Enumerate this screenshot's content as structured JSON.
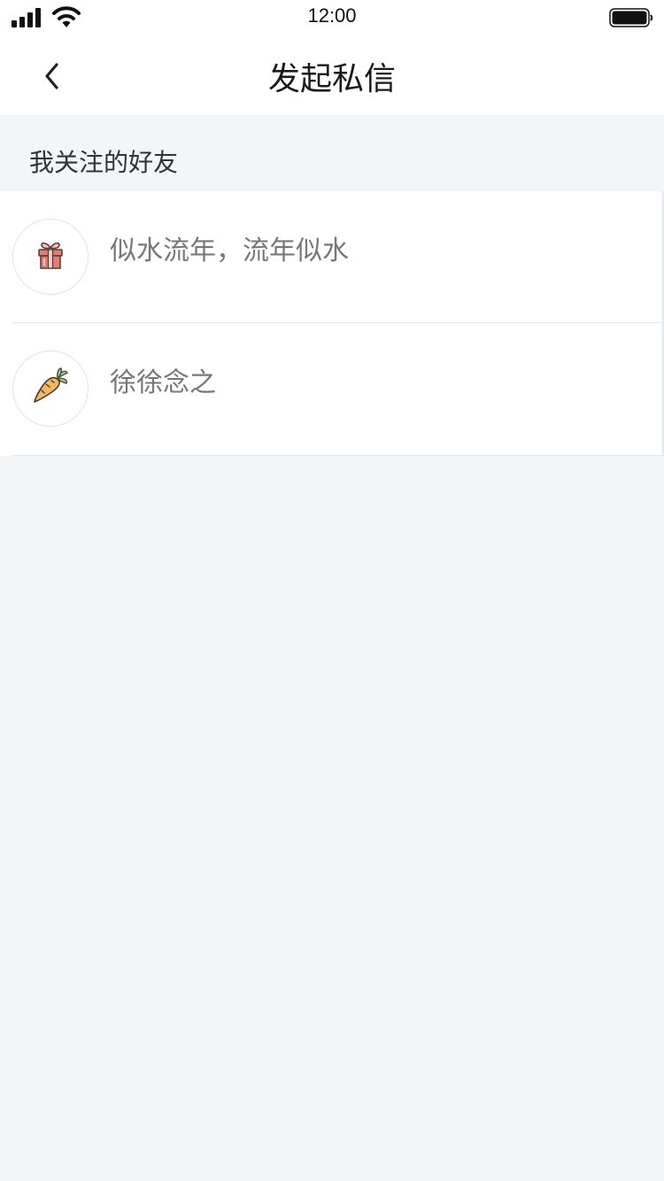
{
  "status_bar": {
    "time": "12:00",
    "signal": "signal-bars-icon",
    "wifi": "wifi-icon",
    "battery": "battery-icon"
  },
  "nav": {
    "title": "发起私信",
    "back_icon": "chevron-left-icon"
  },
  "section": {
    "title": "我关注的好友"
  },
  "friends": [
    {
      "name": "似水流年，流年似水",
      "avatar_icon": "gift-icon"
    },
    {
      "name": "徐徐念之",
      "avatar_icon": "carrot-icon"
    }
  ],
  "colors": {
    "page_background": "#f3f6f9",
    "card_background": "#ffffff",
    "name_text": "#777777",
    "section_text": "#333333",
    "title_text": "#1a1a1a",
    "divider": "#e3e6ea"
  }
}
